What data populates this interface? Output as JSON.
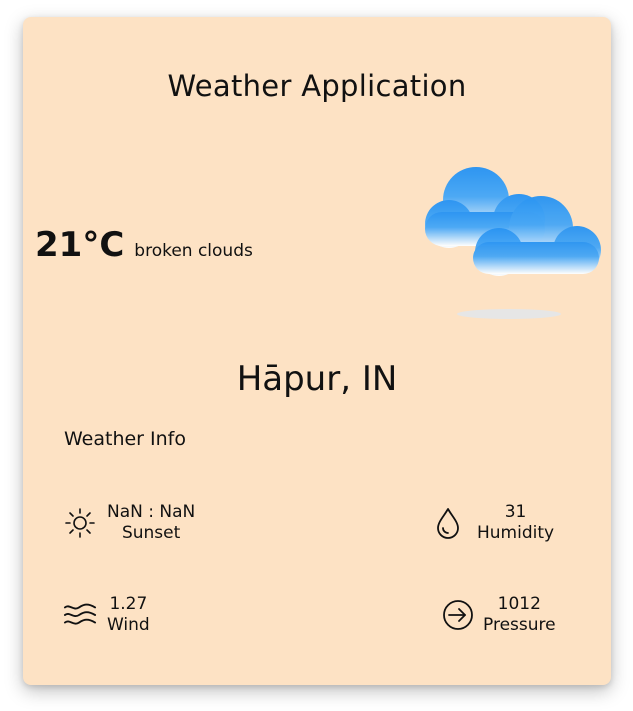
{
  "app": {
    "title": "Weather Application"
  },
  "current": {
    "temperature": "21°C",
    "description": "broken clouds",
    "icon": "broken-clouds-icon"
  },
  "location": "Hāpur, IN",
  "info": {
    "heading": "Weather Info",
    "sunset": {
      "value": "NaN : NaN",
      "label": "Sunset",
      "icon": "sun-icon"
    },
    "humidity": {
      "value": "31",
      "label": "Humidity",
      "icon": "droplet-icon"
    },
    "wind": {
      "value": "1.27",
      "label": "Wind",
      "icon": "wind-icon"
    },
    "pressure": {
      "value": "1012",
      "label": "Pressure",
      "icon": "pressure-icon"
    }
  },
  "colors": {
    "card_bg": "#fde2c4",
    "cloud_blue": "#2f9cf4",
    "text": "#111111"
  }
}
